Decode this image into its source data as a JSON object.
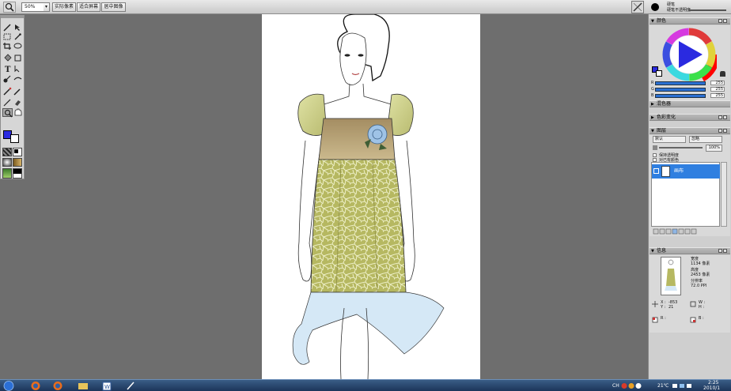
{
  "toolbar": {
    "zoom_value": "50%",
    "actual_pixels": "实际像素",
    "fit_screen": "适合屏幕",
    "center_image": "居中图像",
    "brush_label": "硬笔",
    "opacity_label": "硬笔不透明度"
  },
  "panels": {
    "color": {
      "title": "颜色",
      "channels": [
        {
          "label": "R",
          "value": "255"
        },
        {
          "label": "G",
          "value": "255"
        },
        {
          "label": "B",
          "value": "255"
        }
      ]
    },
    "mixer": {
      "title": "混色器"
    },
    "color_set": {
      "title": "色彩变化"
    },
    "layers": {
      "title": "图层",
      "blend_mode": "默认",
      "composite": "忽略",
      "opacity": "100%",
      "preserve_transparency": "保持透明度",
      "pick_all_layers": "对已有颜色",
      "layer_name": "画布"
    },
    "info": {
      "title": "信息",
      "width_label": "宽度",
      "width_value": "1134 像素",
      "height_label": "高度",
      "height_value": "2453 像素",
      "res_label": "分辨率",
      "res_value": "72.0 PPI",
      "x_label": "X :",
      "x_value": "-853",
      "y_label": "Y :",
      "y_value": "21",
      "w_label": "W :",
      "h_label": "H :",
      "r_label": "R :",
      "b_label": "B :"
    }
  },
  "taskbar": {
    "lang": "CH",
    "time": "2:25",
    "date": "2010/1",
    "temp": "21℃"
  },
  "colors": {
    "primary": "#2a2ae0",
    "secondary": "#ffffff",
    "layer_selected": "#2f7fe0",
    "workspace": "#6e6e6e"
  }
}
